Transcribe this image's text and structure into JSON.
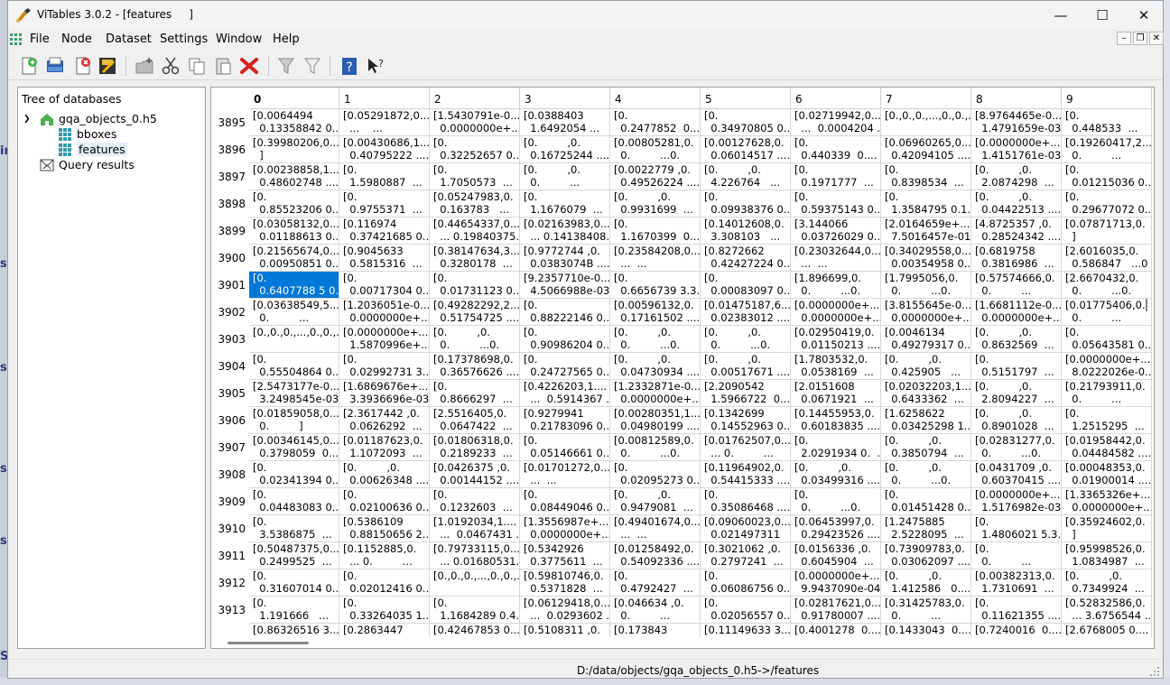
{
  "window": {
    "title": "ViTables 3.0.2 - [features     ]"
  },
  "menu": [
    "File",
    "Node",
    "Dataset",
    "Settings",
    "Window",
    "Help"
  ],
  "tree": {
    "header": "Tree of databases",
    "file": "gqa_objects_0.h5",
    "children": [
      "bboxes",
      "features"
    ],
    "query": "Query results"
  },
  "table": {
    "columns": [
      "0",
      "1",
      "2",
      "3",
      "4",
      "5",
      "6",
      "7",
      "8",
      "9"
    ],
    "rows": [
      {
        "index": "3895",
        "cells": [
          "[0.0064494\n  0.13358842 0....",
          "[0.05291872,0....\n  ...    ...",
          "[1.5430791e-0...\n  0.0000000e+...",
          "[0.0388403\n  1.6492054 ...",
          "[0.\n  0.2477852  0....",
          "[0.\n  0.34970805 0....",
          "[0.02719942,0....\n  ...  0.0004204 ...",
          "[0.,0.,0.,...,0.,0.,...",
          "[8.9764465e-0...\n  1.4791659e-03]",
          "[0.\n  0.448533  ..."
        ]
      },
      {
        "index": "3896",
        "cells": [
          "[0.39980206,0....\n  ]",
          "[0.00430686,1....\n  0.40795222 ......",
          "[0.\n  0.32252657 0....",
          "[0.         ,0.\n  0.16725244 ......",
          "[0.00805281,0.\n  0.         ...0.",
          "[0.00127628,0.\n  0.06014517 ......",
          "[0.\n  0.440339  0....",
          "[0.06960265,0....\n  0.42094105 ......",
          "[0.0000000e+...\n  1.4151761e-03]",
          "[0.19260417,2....\n  0.         ..."
        ]
      },
      {
        "index": "3897",
        "cells": [
          "[0.00238858,1....\n  0.48602748 ......",
          "[0.\n  1.5980887  ...",
          "[0.\n  1.7050573  ...",
          "[0.         ,0.\n  0.         ...",
          "[0.0022779 ,0.\n  0.49526224 ......",
          "[0.         ,0.\n  4.226764   ...",
          "[0.\n  0.1971777  ...",
          "[0.\n  0.8398534  ...",
          "[0.         ,0.\n  2.0874298  ...",
          "[0.\n  0.01215036 0...."
        ]
      },
      {
        "index": "3898",
        "cells": [
          "[0.\n  0.85523206 0....",
          "[0.\n  0.9755371  ...",
          "[0.05247983,0.\n  0.163783   ...",
          "[0.\n  1.1676079  ...",
          "[0.         ,0.\n  0.9931699  ...",
          "[0.\n  0.09938376 0....",
          "[0.\n  0.59375143 0....",
          "[0.\n  1.3584795 0.1...",
          "[0.         ,0.\n  0.04422513 ......",
          "[0.\n  0.29677072 0...."
        ]
      },
      {
        "index": "3899",
        "cells": [
          "[0.03058132,0....\n  0.01188613 0....",
          "[0.116974\n  0.37421685 0....",
          "[0.44654337,0....\n  ... 0.19840375...",
          "[0.02163983,0....\n  ... 0.14138408...",
          "[0.\n  1.1670399  0....",
          "[0.14012608,0.\n  3.308103   ...",
          "[3.144066\n  0.03726029 0....",
          "[2.0164659e+...\n  7.5016457e-01]",
          "[4.8725357 ,0.\n  0.28524342 ......",
          "[0.07871713,0.\n  ]"
        ]
      },
      {
        "index": "3900",
        "cells": [
          "[0.21565674,0....\n  0.00950851 0....",
          "[0.9045633\n  0.5815316  ...",
          "[0.38147634,3....\n  0.3280178  ...",
          "[0.9772744 ,0.\n  0.0383074B ......",
          "[0.23584208,0....\n  ...  ...",
          "[0.8272662\n  0.42427224 0....",
          "[0.23032644,0....\n  ...  ...",
          "[0.34029558,0....\n  0.00354958 0....",
          "[0.6819758\n  0.3816986  ...",
          "[2.6016035,0.\n  0.586847   ...0"
        ]
      },
      {
        "index": "3901",
        "cells": [
          "[0.\n  0.6407788 5 0...",
          "[0.\n  0.00717304 0....",
          "[0.\n  0.01731123 0....",
          "[9.2357710e-0...\n  4.5066988e-03]",
          "[0.\n  0.6656739 3.3...",
          "[0.\n  0.00083097 0....",
          "[1.896699,0.\n  0.         ...0.",
          "[1.7995056,0.\n  0.         ...0.",
          "[0.57574666,0.\n  0.         ...",
          "[2.6670432,0.\n  0.         ...0."
        ]
      },
      {
        "index": "3902",
        "cells": [
          "[0.03638549,5....\n  0.         ...",
          "[1.2036051e-0...\n  0.0000000e+...",
          "[0.49282292,2....\n  0.51754725 ......",
          "[0.\n  0.88222146 0....",
          "[0.00596132,0.\n  0.17161502 ......",
          "[0.01475187,6....\n  0.02383012 ......",
          "[0.0000000e+...\n  0.0000000e+...",
          "[3.8155645e-0...\n  0.0000000e+...",
          "[1.6681112e-0...\n  0.0000000e+...",
          "[0.01775406,0.\n  0.         ..."
        ]
      },
      {
        "index": "3903",
        "cells": [
          "[0.,0.,0.,...,0.,0.,...",
          "[0.0000000e+...\n  1.5870996e+...",
          "[0.         ,0.\n  0.         ...0.",
          "[0.\n  0.90986204 0....",
          "[0.         ,0.\n  0.         ...0.",
          "[0.         ,0.\n  0.         ...0.",
          "[0.02950419,0.\n  0.01150213 ......",
          "[0.0046134\n  0.49279317 0....",
          "[0.         ,0.\n  0.8632569  ...",
          "[0.\n  0.05643581 0...."
        ]
      },
      {
        "index": "3904",
        "cells": [
          "[0.\n  0.55504864 0....",
          "[0.\n  0.02992731 3....",
          "[0.17378698,0.\n  0.36576626 ......",
          "[0.\n  0.24727565 0....",
          "[0.         ,0.\n  0.04730934 ......",
          "[0.         ,0.\n  0.00517671 ......",
          "[1.7803532,0.\n  0.0538169  ...",
          "[0.         ,0.\n  0.425905   ...",
          "[0.\n  0.5151797  ...",
          "[0.0000000e+...\n  8.0222026e-0..."
        ]
      },
      {
        "index": "3905",
        "cells": [
          "[2.5473177e-0...\n  3.2498545e-03]",
          "[1.6869676e+...\n  3.3936696e-03]",
          "[0.\n  0.8666297  ...",
          "[0.4226203,1....\n  ...  0.5914367 ...",
          "[1.2332871e-0...\n  0.0000000e+...",
          "[2.2090542\n  1.5966722  0....",
          "[2.0151608\n  0.0671921  ...",
          "[0.02032203,1....\n  0.6433362  ...",
          "[0.         ,0.\n  2.8094227  ...",
          "[0.21793911,0.\n  0.         ..."
        ]
      },
      {
        "index": "3906",
        "cells": [
          "[0.01859058,0....\n  0.         ]",
          "[2.3617442 ,0.\n  0.0626292  ...",
          "[2.5516405,0.\n  0.0647422  ...",
          "[0.9279941\n  0.21783096 0....",
          "[0.00280351,1....\n  0.04980199 ......",
          "[0.1342699\n  0.14552963 0....",
          "[0.14455953,0.\n  0.60183835 ......",
          "[1.6258622\n  0.03425298 1....",
          "[0.         ,0.\n  0.8901028  ...",
          "[0.\n  1.2515295  ..."
        ]
      },
      {
        "index": "3907",
        "cells": [
          "[0.00346145,0....\n  0.3798059  0....",
          "[0.01187623,0.\n  1.1072093  ...",
          "[0.01806318,0.\n  0.2189233  ...",
          "[0.\n  0.05146661 0....",
          "[0.00812589,0.\n  0.         ...0.",
          "[0.01762507,0....\n  ... 0.         ...",
          "[0.\n  2.0291934 0.  ...",
          "[0.         ,0.\n  0.3850794  ...",
          "[0.02831277,0.\n  0.         ...0.",
          "[0.01958442,0.\n  0.04484582 ......"
        ]
      },
      {
        "index": "3908",
        "cells": [
          "[0.\n  0.02341394 0....",
          "[0.         ,0.\n  0.00626348 ......",
          "[0.0426375 ,0.\n  0.00144152 ......",
          "[0.01701272,0....\n  ...  ...",
          "[0.\n  0.02095273 0....",
          "[0.11964902,0.\n  0.54415333 ......",
          "[0.         ,0.\n  0.03499316 ......",
          "[0.         ,0.\n  0.         ...0.",
          "[0.0431709 ,0.\n  0.60370415 ......",
          "[0.00048353,0.\n  0.01900014 ......"
        ]
      },
      {
        "index": "3909",
        "cells": [
          "[0.\n  0.04483083 0....",
          "[0.\n  0.02100636 0....",
          "[0.\n  0.1232603  ...",
          "[0.\n  0.08449046 0....",
          "[0.         ,0.\n  0.9479081  ...",
          "[0.\n  0.35086468 ......",
          "[0.\n  0.         ...0.",
          "[0.\n  0.01451428 0....",
          "[0.0000000e+...\n  1.5176982e-03]",
          "[1.3365326e+...\n  0.0000000e+..."
        ]
      },
      {
        "index": "3910",
        "cells": [
          "[0.\n  3.5386875  ...",
          "[0.5386109\n  0.88150656 2....",
          "[1.0192034,1....\n  ...  0.0467431 ...",
          "[1.3556987e+...\n  0.0000000e+...",
          "[0.49401674,0....\n  ...  ...",
          "[0.09060023,0....\n  0.021497311",
          "[0.06453997,0.\n  0.29423526 ......",
          "[1.2475885\n  2.5228095  ...",
          "[0.\n  1.4806021 5.3...",
          "[0.35924602,0.\n  ]"
        ]
      },
      {
        "index": "3911",
        "cells": [
          "[0.50487375,0....\n  0.2499525  ...",
          "[0.1152885,0.\n  ... 0.         ...",
          "[0.79733115,0....\n  ... 0.01680531...",
          "[0.5342926\n  0.3775611  ...",
          "[0.01258492,0.\n  0.54092336 ......",
          "[0.3021062 ,0.\n  0.2797241  ...",
          "[0.0156336 ,0.\n  0.6045904  ...",
          "[0.73909783,0.\n  0.03062097 ......",
          "[0.\n  0.         ...",
          "[0.95998526,0.\n  1.0834987  ..."
        ]
      },
      {
        "index": "3912",
        "cells": [
          "[0.\n  0.31607014 0....",
          "[0.\n  0.02012416 0....",
          "[0.,0.,0.,...,0.,0.,...",
          "[0.59810746,0.\n  0.5371828  ...",
          "[0.\n  0.4792427  ...",
          "[0.\n  0.06086756 0....",
          "[0.0000000e+...\n  9.9437090e-04]",
          "[0.         ,0.\n  1.412586   0....",
          "[0.00382313,0.\n  1.7310691  ...",
          "[0.         ,0.\n  0.7349924  ..."
        ]
      },
      {
        "index": "3913",
        "cells": [
          "[0.\n  1.191666   ...",
          "[0.\n  0.33264035 1....",
          "[0.\n  1.1684289 0.4...",
          "[0.06129418,0....\n  ...  0.0293602 ...",
          "[0.046634 ,0.\n  0.         ...",
          "[0.\n  0.02056557 0....",
          "[0.02817621,0....\n  0.91780007 ......",
          "[0.31425783,0.\n  0.         ...",
          "[0.\n  0.11621355 ......",
          "[0.52832586,0.\n  ... 3.6756544 ..."
        ]
      },
      {
        "index": "",
        "cells": [
          "[0.86326516 3....",
          "[0.2863447",
          "[0.42467853 0....",
          "[0.5108311 ,0.",
          "[0.173843",
          "[0.11149633 3....",
          "[0.4001278  0....",
          "[0.1433043  0....",
          "[0.7240016  0....",
          "[2.6768005 0...."
        ]
      }
    ]
  },
  "status": "D:/data/objects/gqa_objects_0.h5->/features",
  "colors": {
    "selection": "#0078d7",
    "folder": "#4caf50",
    "dataset": "#2e9aa8"
  }
}
